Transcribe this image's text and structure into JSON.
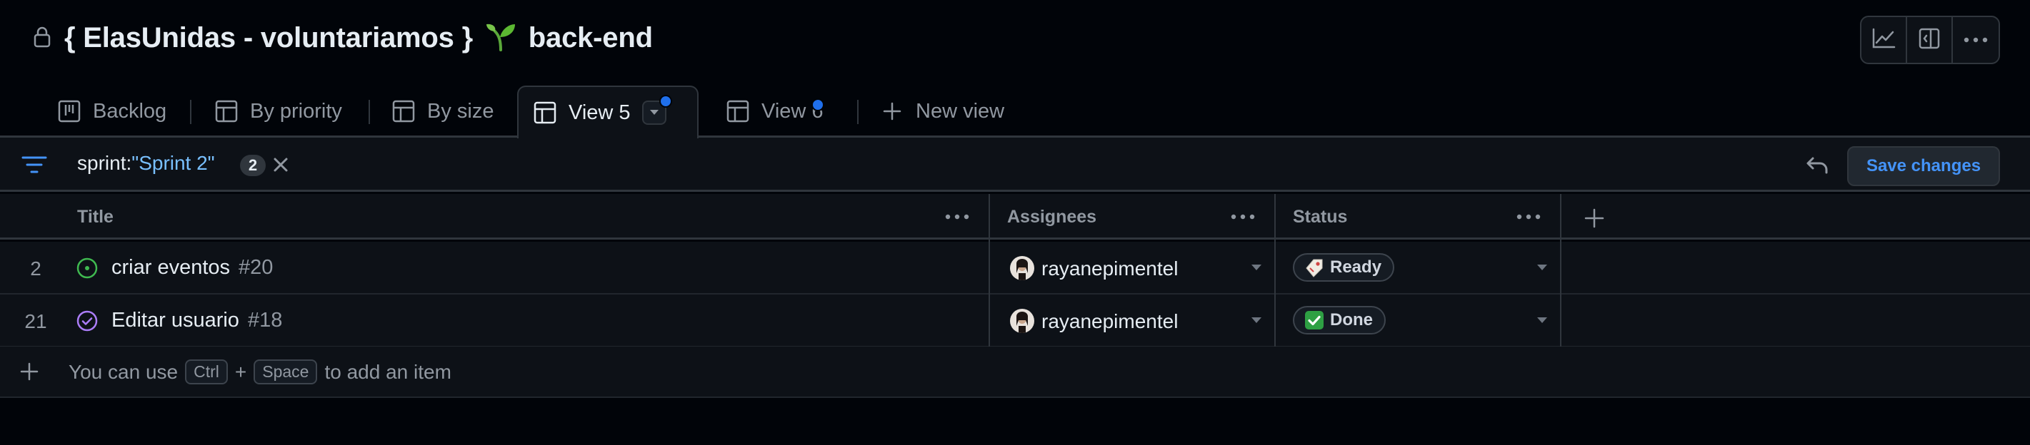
{
  "header": {
    "title_prefix": "{ ElasUnidas - voluntariamos }",
    "title_suffix": "back-end",
    "icons": [
      "lock-icon",
      "sprout-emoji"
    ],
    "toolbar": [
      "insights-graph-icon",
      "side-panel-icon",
      "kebab-menu-icon"
    ]
  },
  "tabs": [
    {
      "label": "Backlog",
      "icon": "board-icon"
    },
    {
      "label": "By priority",
      "icon": "table-icon"
    },
    {
      "label": "By size",
      "icon": "table-icon"
    },
    {
      "label": "View 5",
      "icon": "table-icon",
      "active": true,
      "unsaved": true
    },
    {
      "label": "View 6",
      "icon": "table-icon",
      "unsaved": true
    },
    {
      "label": "New view",
      "icon": "plus-icon"
    }
  ],
  "filter": {
    "key": "sprint:",
    "value": "\"Sprint 2\"",
    "count": "2",
    "save_label": "Save changes"
  },
  "columns": {
    "title": "Title",
    "assignees": "Assignees",
    "status": "Status"
  },
  "rows": [
    {
      "num": "2",
      "title": "criar eventos",
      "issue": "#20",
      "state": "open",
      "assignee": "rayanepimentel",
      "status": "Ready",
      "status_emoji": "tag"
    },
    {
      "num": "21",
      "title": "Editar usuario",
      "issue": "#18",
      "state": "closed",
      "assignee": "rayanepimentel",
      "status": "Done",
      "status_emoji": "check"
    }
  ],
  "add_item": {
    "prefix": "You can use",
    "key1": "Ctrl",
    "plus": "+",
    "key2": "Space",
    "suffix": "to add an item"
  },
  "colors": {
    "accent": "#1f6feb",
    "link": "#4493f8",
    "open": "#3fb950",
    "done": "#ab7df8",
    "done_emoji": "#2ea043"
  }
}
